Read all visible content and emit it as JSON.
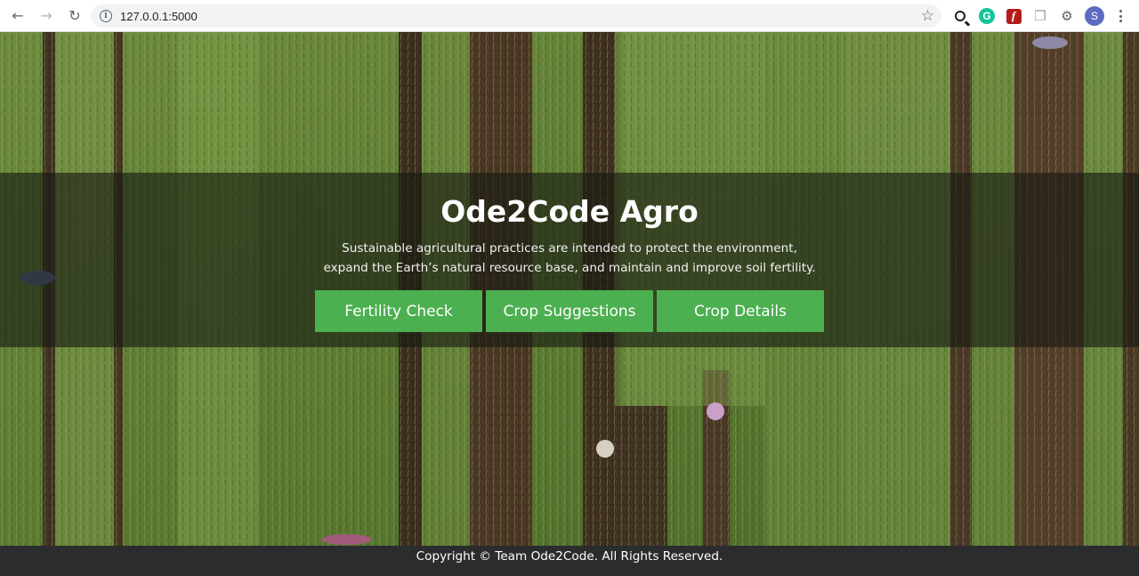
{
  "browser": {
    "url": "127.0.0.1:5000",
    "profile_initial": "S",
    "icons": [
      "back-icon",
      "forward-icon",
      "reload-icon",
      "info-icon",
      "star-icon",
      "zoom-icon",
      "grammarly-icon",
      "flash-icon",
      "copy-icon",
      "puzzle-icon",
      "menu-icon"
    ]
  },
  "hero": {
    "title": "Ode2Code Agro",
    "subtitle_line1": "Sustainable agricultural practices are intended to protect the environment,",
    "subtitle_line2": "expand the Earth’s natural resource base, and maintain and improve soil fertility.",
    "buttons": [
      {
        "label": "Fertility Check"
      },
      {
        "label": "Crop Suggestions"
      },
      {
        "label": "Crop Details"
      }
    ]
  },
  "footer": {
    "text": "Copyright © Team Ode2Code. All Rights Reserved."
  },
  "colors": {
    "button_green": "#4caf50",
    "footer_bg": "#2a2c2e",
    "field_green": "#4f6a2e",
    "soil_brown": "#4a3324"
  }
}
